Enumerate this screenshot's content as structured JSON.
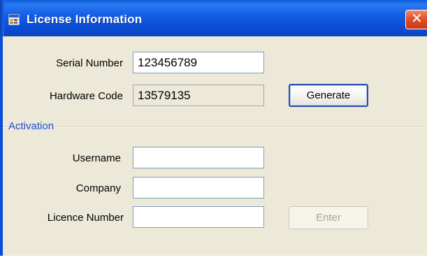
{
  "window": {
    "title": "License Information",
    "close_glyph": "✕"
  },
  "fields": {
    "serial_number": {
      "label": "Serial Number",
      "value": "123456789"
    },
    "hardware_code": {
      "label": "Hardware Code",
      "value": "13579135"
    },
    "generate_button": "Generate"
  },
  "activation": {
    "group_label": "Activation",
    "username": {
      "label": "Username",
      "value": ""
    },
    "company": {
      "label": "Company",
      "value": ""
    },
    "licence_number": {
      "label": "Licence Number",
      "value": ""
    },
    "enter_button": "Enter"
  },
  "icons": {
    "app": "app-window-icon",
    "close": "close-icon"
  },
  "colors": {
    "titlebar": "#0b4fd6",
    "close_button": "#e0512c",
    "client_background": "#ece9d8",
    "group_label": "#1f4fd0",
    "disabled_text": "#a7a69a"
  }
}
